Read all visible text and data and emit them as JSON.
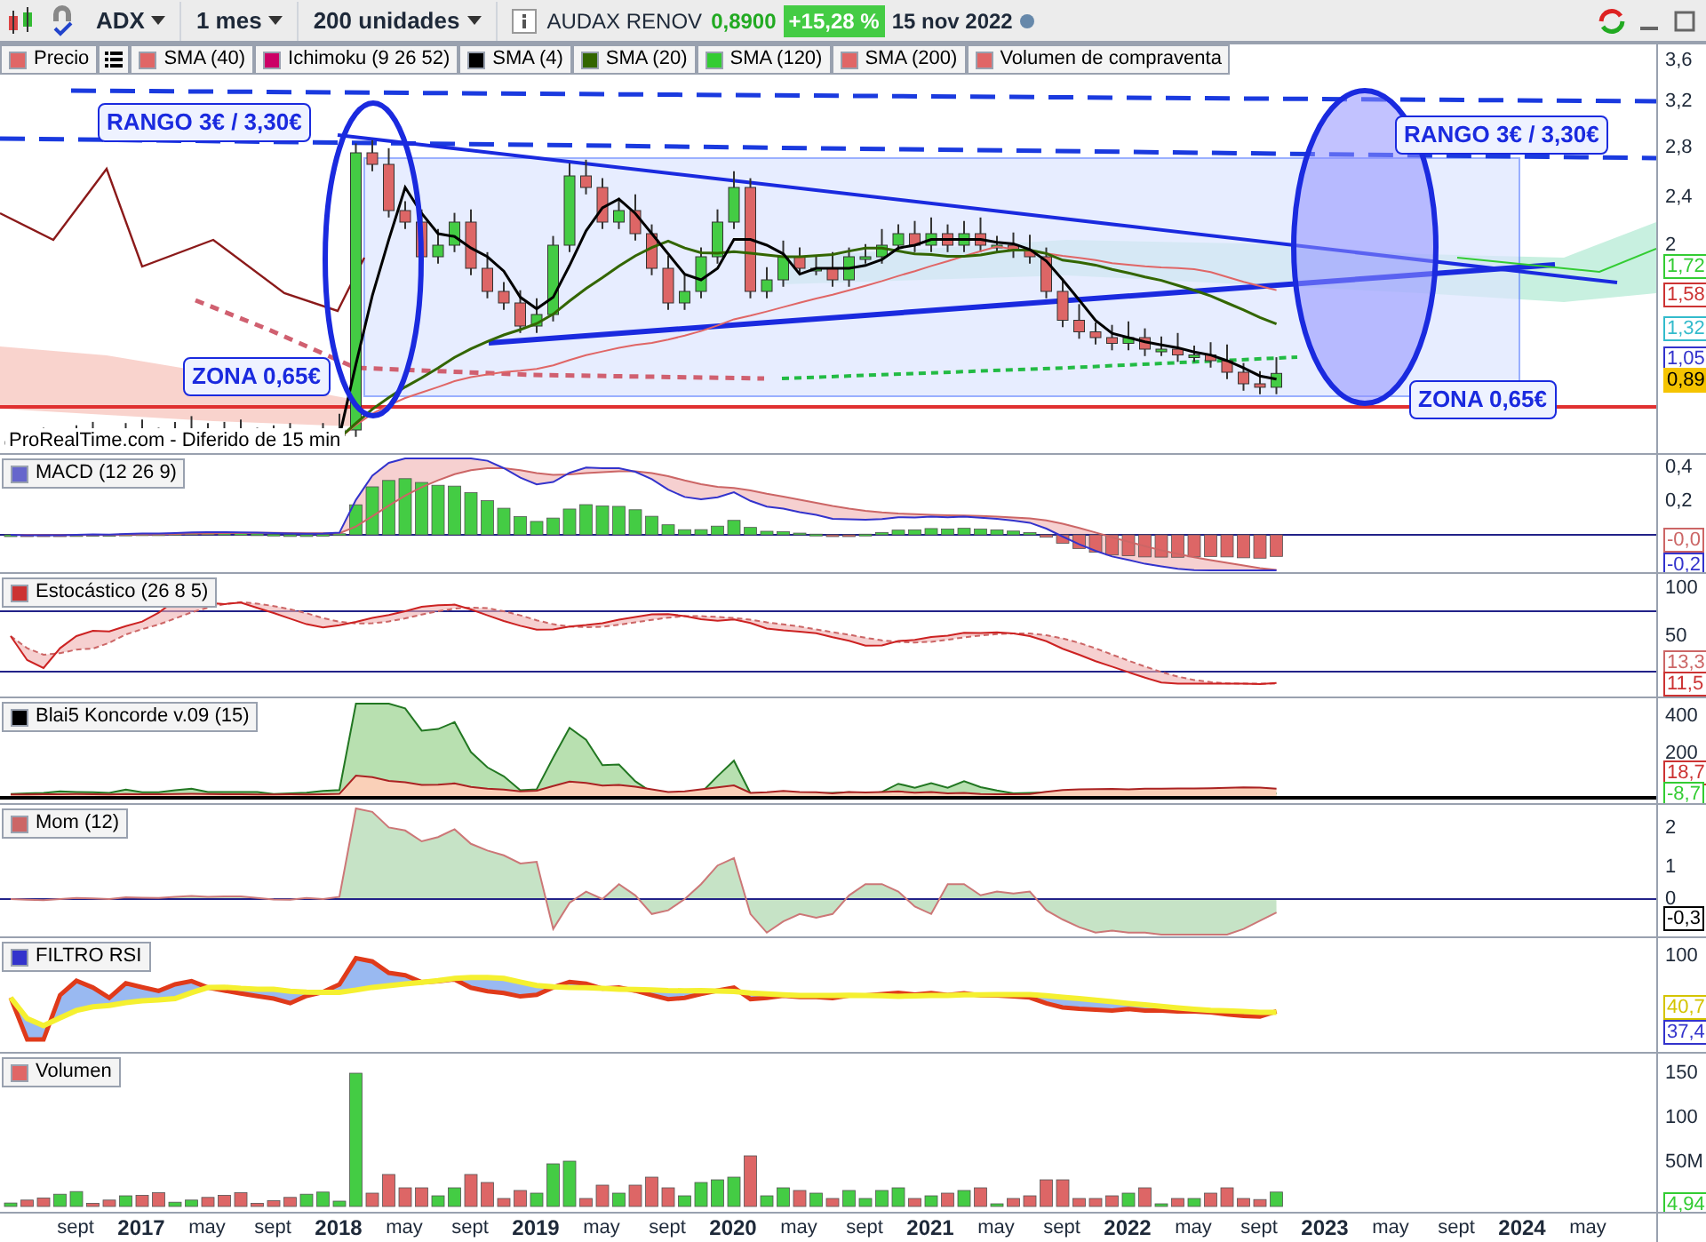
{
  "toolbar": {
    "symbol": "ADX",
    "period": "1 mes",
    "units": "200 unidades",
    "name": "AUDAX RENOV",
    "price": "0,8900",
    "change": "+15,28 %",
    "date": "15 nov 2022"
  },
  "legend": [
    {
      "label": "Precio",
      "color": "#e06666"
    },
    {
      "label": "SMA (40)",
      "color": "#e06666"
    },
    {
      "label": "Ichimoku (9 26 52)",
      "color": "#cc0066"
    },
    {
      "label": "SMA (4)",
      "color": "#000000"
    },
    {
      "label": "SMA (20)",
      "color": "#336600"
    },
    {
      "label": "SMA (120)",
      "color": "#33cc33"
    },
    {
      "label": "SMA (200)",
      "color": "#e06666"
    },
    {
      "label": "Volumen de compraventa",
      "color": "#e06666"
    }
  ],
  "annotations": {
    "range_left": "RANGO 3€ / 3,30€",
    "range_right": "RANGO 3€ / 3,30€",
    "zone_left": "ZONA 0,65€",
    "zone_right": "ZONA 0,65€",
    "source": "ProRealTime.com - Diferido de 15 min"
  },
  "panels": [
    {
      "kind": "price",
      "ticks": [
        "3,6",
        "3,2",
        "2,8",
        "2,4",
        "2"
      ],
      "tags": [
        {
          "text": "1,72",
          "color": "#33cc33",
          "current": false
        },
        {
          "text": "1,58",
          "color": "#cc3333",
          "current": false
        },
        {
          "text": "1,32",
          "color": "#33bbcc",
          "current": false
        },
        {
          "text": "1,05",
          "color": "#3333cc",
          "current": false
        },
        {
          "text": "0,89",
          "color": "#f5c400",
          "current": true
        }
      ]
    },
    {
      "kind": "macd",
      "title": "MACD (12 26 9)",
      "color": "#6666cc",
      "ticks": [
        "0,4",
        "0,2"
      ],
      "tags": [
        {
          "text": "-0,0",
          "color": "#cc6666",
          "current": false
        },
        {
          "text": "-0,2",
          "color": "#3333cc",
          "current": false
        }
      ]
    },
    {
      "kind": "stochastic",
      "title": "Estocástico (26 8 5)",
      "color": "#cc3333",
      "ticks": [
        "100",
        "50"
      ],
      "tags": [
        {
          "text": "13,3",
          "color": "#cc6666",
          "current": false
        },
        {
          "text": "11,5",
          "color": "#cc3333",
          "current": false
        }
      ]
    },
    {
      "kind": "koncorde",
      "title": "Blai5 Koncorde v.09 (15)",
      "color": "#000000",
      "ticks": [
        "400",
        "200"
      ],
      "tags": [
        {
          "text": "18,7",
          "color": "#cc3333",
          "current": false
        },
        {
          "text": "-8,7",
          "color": "#33cc33",
          "current": false
        }
      ]
    },
    {
      "kind": "momentum",
      "title": "Mom (12)",
      "color": "#cc6666",
      "ticks": [
        "2",
        "1",
        "0"
      ],
      "tags": [
        {
          "text": "-0,3",
          "color": "#000000",
          "current": false
        }
      ]
    },
    {
      "kind": "rsi",
      "title": "FILTRO RSI",
      "color": "#3333cc",
      "ticks": [
        "100"
      ],
      "tags": [
        {
          "text": "40,7",
          "color": "#d4c400",
          "current": false
        },
        {
          "text": "37,4",
          "color": "#3333cc",
          "current": false
        }
      ]
    },
    {
      "kind": "volume",
      "title": "Volumen",
      "color": "#e06666",
      "ticks": [
        "150",
        "100",
        "50M"
      ],
      "tags": [
        {
          "text": "4,94",
          "color": "#33cc33",
          "current": false
        }
      ]
    }
  ],
  "time_axis": [
    {
      "label": "sept",
      "kind": "month"
    },
    {
      "label": "2017",
      "kind": "year"
    },
    {
      "label": "may",
      "kind": "month"
    },
    {
      "label": "sept",
      "kind": "month"
    },
    {
      "label": "2018",
      "kind": "year"
    },
    {
      "label": "may",
      "kind": "month"
    },
    {
      "label": "sept",
      "kind": "month"
    },
    {
      "label": "2019",
      "kind": "year"
    },
    {
      "label": "may",
      "kind": "month"
    },
    {
      "label": "sept",
      "kind": "month"
    },
    {
      "label": "2020",
      "kind": "year"
    },
    {
      "label": "may",
      "kind": "month"
    },
    {
      "label": "sept",
      "kind": "month"
    },
    {
      "label": "2021",
      "kind": "year"
    },
    {
      "label": "may",
      "kind": "month"
    },
    {
      "label": "sept",
      "kind": "month"
    },
    {
      "label": "2022",
      "kind": "year"
    },
    {
      "label": "may",
      "kind": "month"
    },
    {
      "label": "sept",
      "kind": "month"
    },
    {
      "label": "2023",
      "kind": "year"
    },
    {
      "label": "may",
      "kind": "month"
    },
    {
      "label": "sept",
      "kind": "month"
    },
    {
      "label": "2024",
      "kind": "year"
    },
    {
      "label": "may",
      "kind": "month"
    }
  ]
}
